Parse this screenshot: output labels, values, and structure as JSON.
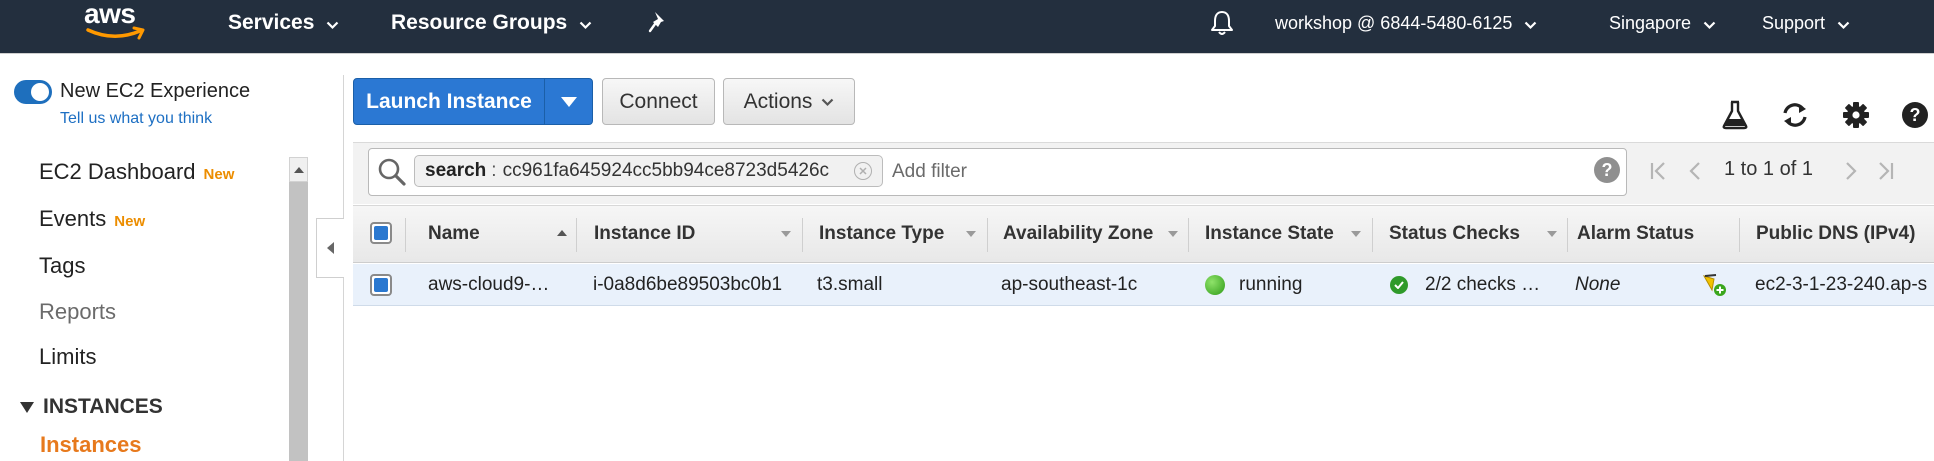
{
  "topnav": {
    "logo": "aws",
    "services": "Services",
    "resource_groups": "Resource Groups",
    "account": "workshop @ 6844-5480-6125",
    "region": "Singapore",
    "support": "Support"
  },
  "sidebar": {
    "experience_title": "New EC2 Experience",
    "experience_link": "Tell us what you think",
    "items": [
      {
        "label": "EC2 Dashboard",
        "badge": "New"
      },
      {
        "label": "Events",
        "badge": "New"
      },
      {
        "label": "Tags"
      },
      {
        "label": "Reports"
      },
      {
        "label": "Limits"
      }
    ],
    "section": "INSTANCES",
    "active_item": "Instances"
  },
  "toolbar": {
    "launch": "Launch Instance",
    "connect": "Connect",
    "actions": "Actions"
  },
  "filter": {
    "token_key": "search",
    "token_value": "cc961fa645924cc5bb94ce8723d5426c",
    "placeholder": "Add filter",
    "pagination": "1 to 1 of 1"
  },
  "table": {
    "columns": [
      "Name",
      "Instance ID",
      "Instance Type",
      "Availability Zone",
      "Instance State",
      "Status Checks",
      "Alarm Status",
      "Public DNS (IPv4)"
    ],
    "rows": [
      {
        "name": "aws-cloud9-…",
        "instance_id": "i-0a8d6be89503bc0b1",
        "instance_type": "t3.small",
        "availability_zone": "ap-southeast-1c",
        "instance_state": "running",
        "status_checks": "2/2 checks …",
        "alarm_status": "None",
        "public_dns": "ec2-3-1-23-240.ap-s"
      }
    ]
  },
  "colors": {
    "nav_bg": "#232f3e",
    "primary": "#2b78d3",
    "accent_orange": "#e7791c",
    "running_green": "#3aa61c"
  },
  "icons": [
    "bell-icon",
    "pin-icon",
    "flask-icon",
    "refresh-icon",
    "gear-icon",
    "help-icon",
    "search-icon",
    "alarm-add-icon"
  ]
}
